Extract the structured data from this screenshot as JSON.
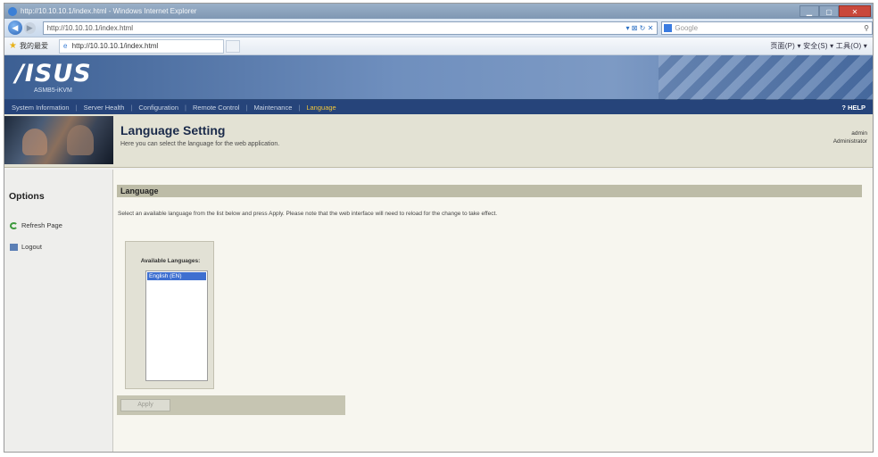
{
  "browser": {
    "title": "http://10.10.10.1/index.html - Windows Internet Explorer",
    "url": "http://10.10.10.1/index.html",
    "search_placeholder": "Google",
    "favorites_label": "我的最爱",
    "tab_title": "http://10.10.10.1/index.html",
    "command_bar": "页面(P) ▾  安全(S) ▾  工具(O) ▾"
  },
  "header": {
    "logo": "/ISUS",
    "sublogo": "ASMB5-iKVM",
    "nav": [
      "System Information",
      "Server Health",
      "Configuration",
      "Remote Control",
      "Maintenance",
      "Language"
    ],
    "active_nav": "Language",
    "help": "? HELP"
  },
  "page": {
    "title": "Language Setting",
    "description": "Here you can select the language for the web application.",
    "user_name": "admin",
    "user_role": "Administrator"
  },
  "sidebar": {
    "title": "Options",
    "items": [
      {
        "label": "Refresh Page",
        "icon": "refresh-icon"
      },
      {
        "label": "Logout",
        "icon": "logout-icon"
      }
    ]
  },
  "main": {
    "section_title": "Language",
    "instruction": "Select an available language from the list below and press Apply. Please note that the web interface will need to reload for the change to take effect.",
    "available_label": "Available Languages:",
    "languages": [
      "English (EN)"
    ],
    "selected_language": "English (EN)",
    "apply_label": "Apply"
  }
}
